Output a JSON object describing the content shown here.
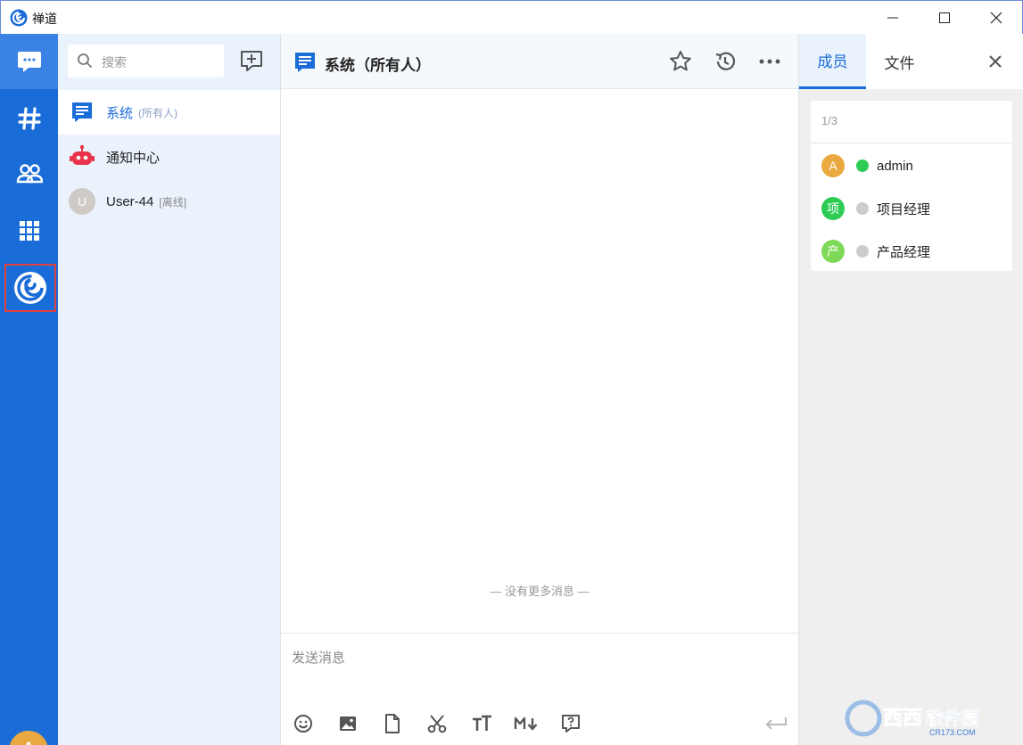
{
  "window": {
    "title": "禅道",
    "minimize_glyph": "—",
    "maximize_glyph": "☐",
    "close_glyph": "✕"
  },
  "rail": {
    "items": [
      {
        "name": "chat",
        "icon": "chat-bubble-icon",
        "active": true
      },
      {
        "name": "channels",
        "icon": "hash-icon"
      },
      {
        "name": "contacts",
        "icon": "users-icon"
      },
      {
        "name": "apps",
        "icon": "grid-icon"
      },
      {
        "name": "zentao",
        "icon": "zentao-logo-icon",
        "highlighted": true
      }
    ],
    "user_avatar": "A",
    "user_status": "online"
  },
  "list": {
    "search_placeholder": "搜索",
    "chats": [
      {
        "name": "系统",
        "sub": "(所有人)",
        "icon": "system-chat-icon",
        "selected": true
      },
      {
        "name": "通知中心",
        "sub": "",
        "icon": "robot-icon"
      },
      {
        "name": "User-44",
        "sub": "[离线]",
        "avatar": "U"
      }
    ]
  },
  "chat": {
    "title": "系统（所有人）",
    "no_more": "— 没有更多消息 —",
    "composer_placeholder": "发送消息",
    "tools": [
      "emoji-icon",
      "image-icon",
      "file-icon",
      "screenshot-icon",
      "font-size-icon",
      "markdown-icon",
      "help-icon"
    ],
    "markdown_label": "M↓",
    "font_label": "TT"
  },
  "panel": {
    "tabs": [
      "成员",
      "文件"
    ],
    "active_tab": 0,
    "member_count": "1/3",
    "members": [
      {
        "avatar": "A",
        "name": "admin",
        "avatar_color": "#e9a940",
        "status": "online",
        "status_color": "#2ecc55"
      },
      {
        "avatar": "项",
        "name": "项目经理",
        "avatar_color": "#2ecc55",
        "status": "offline",
        "status_color": "#cccccc"
      },
      {
        "avatar": "产",
        "name": "产品经理",
        "avatar_color": "#7ed957",
        "status": "offline",
        "status_color": "#cccccc"
      }
    ]
  },
  "watermark": {
    "text": "西西软件园",
    "sub": "CR173.COM"
  },
  "colors": {
    "accent": "#1a6cd8",
    "rail": "#1a6cd8",
    "robot": "#e8334a"
  }
}
